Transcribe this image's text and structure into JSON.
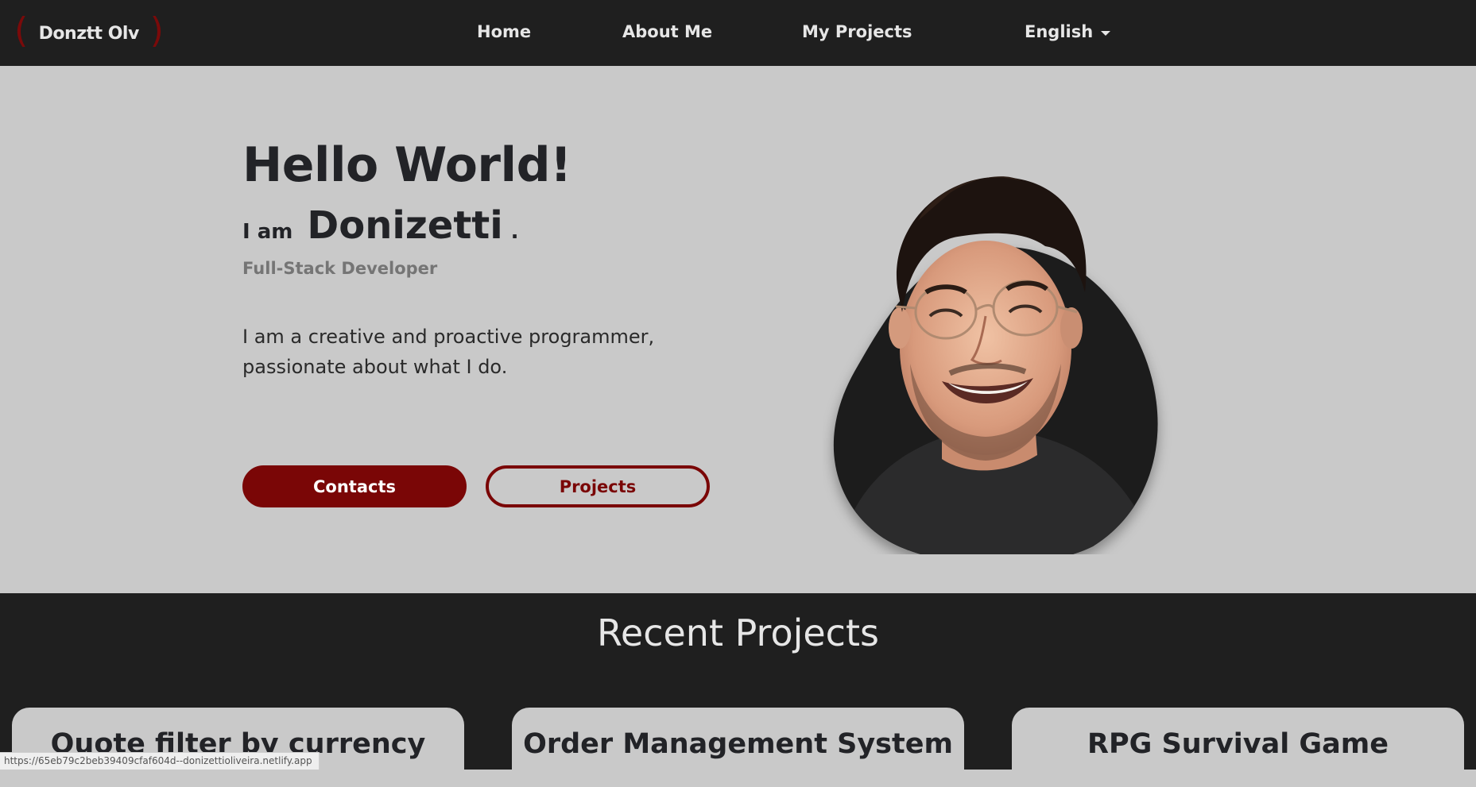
{
  "navbar": {
    "brand": "Donztt Olv",
    "links": {
      "home": "Home",
      "about": "About Me",
      "projects": "My Projects"
    },
    "language": "English"
  },
  "hero": {
    "greeting": "Hello World!",
    "iam": "I am",
    "name": "Donizetti",
    "dot": ".",
    "role": "Full-Stack Developer",
    "bio_line1": "I am a creative and proactive programmer,",
    "bio_line2": "passionate about what I do.",
    "contacts_button": "Contacts",
    "projects_button": "Projects"
  },
  "recent": {
    "title": "Recent Projects",
    "cards": [
      {
        "title": "Quote filter by currency"
      },
      {
        "title": "Order Management System"
      },
      {
        "title": "RPG Survival Game"
      }
    ]
  },
  "status_bar": {
    "url": "https://65eb79c2beb39409cfaf604d--donizettioliveira.netlify.app"
  },
  "colors": {
    "accent": "#7a0606",
    "nav_bg": "#1f1f1f",
    "page_bg": "#c9c9c9",
    "text_dark": "#222327"
  }
}
